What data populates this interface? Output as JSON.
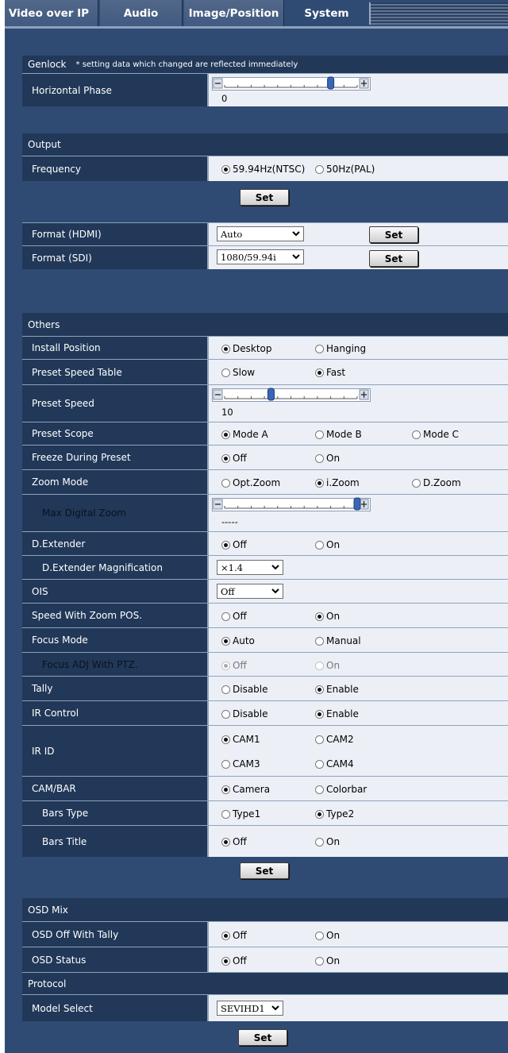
{
  "tabs": [
    "Video over IP",
    "Audio",
    "Image/Position",
    "System"
  ],
  "genlock": {
    "title": "Genlock",
    "note": "* setting data which changed are reflected immediately",
    "hphase_label": "Horizontal Phase",
    "hphase_value": "0",
    "hphase_level": 0.8
  },
  "output": {
    "title": "Output",
    "freq_label": "Frequency",
    "freq_options": [
      "59.94Hz(NTSC)",
      "50Hz(PAL)"
    ],
    "freq_selected": 0,
    "set_label": "Set",
    "hdmi_label": "Format (HDMI)",
    "hdmi_value": "Auto",
    "sdi_label": "Format (SDI)",
    "sdi_value": "1080/59.94i"
  },
  "others": {
    "title": "Others",
    "install_label": "Install Position",
    "install_opts": [
      "Desktop",
      "Hanging"
    ],
    "pst_label": "Preset Speed Table",
    "pst_opts": [
      "Slow",
      "Fast"
    ],
    "ps_label": "Preset Speed",
    "ps_value": "10",
    "ps_level": 0.35,
    "scope_label": "Preset Scope",
    "scope_opts": [
      "Mode A",
      "Mode B",
      "Mode C"
    ],
    "freeze_label": "Freeze During Preset",
    "freeze_opts": [
      "Off",
      "On"
    ],
    "zoom_label": "Zoom Mode",
    "zoom_opts": [
      "Opt.Zoom",
      "i.Zoom",
      "D.Zoom"
    ],
    "mdz_label": "Max Digital Zoom",
    "mdz_value": "-----",
    "mdz_level": 1.0,
    "dext_label": "D.Extender",
    "dext_opts": [
      "Off",
      "On"
    ],
    "dmag_label": "D.Extender Magnification",
    "dmag_value": "×1.4",
    "ois_label": "OIS",
    "ois_value": "Off",
    "szp_label": "Speed With Zoom POS.",
    "szp_opts": [
      "Off",
      "On"
    ],
    "fm_label": "Focus Mode",
    "fm_opts": [
      "Auto",
      "Manual"
    ],
    "fadj_label": "Focus ADJ With PTZ.",
    "fadj_opts": [
      "Off",
      "On"
    ],
    "tally_label": "Tally",
    "tally_opts": [
      "Disable",
      "Enable"
    ],
    "irc_label": "IR Control",
    "irc_opts": [
      "Disable",
      "Enable"
    ],
    "irid_label": "IR ID",
    "irid_opts": [
      "CAM1",
      "CAM2",
      "CAM3",
      "CAM4"
    ],
    "cambar_label": "CAM/BAR",
    "cambar_opts": [
      "Camera",
      "Colorbar"
    ],
    "btype_label": "Bars Type",
    "btype_opts": [
      "Type1",
      "Type2"
    ],
    "btitle_label": "Bars Title",
    "btitle_opts": [
      "Off",
      "On"
    ],
    "set_label": "Set"
  },
  "osd": {
    "title": "OSD Mix",
    "tally_label": "OSD Off With Tally",
    "tally_opts": [
      "Off",
      "On"
    ],
    "status_label": "OSD Status",
    "status_opts": [
      "Off",
      "On"
    ]
  },
  "protocol": {
    "title": "Protocol",
    "model_label": "Model Select",
    "model_value": "SEVIHD1",
    "set_label": "Set"
  }
}
